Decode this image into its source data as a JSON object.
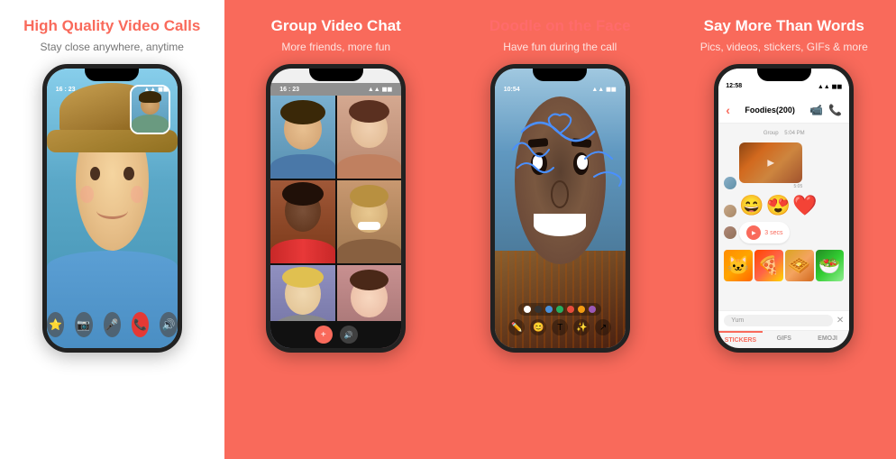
{
  "panels": [
    {
      "id": "panel-1",
      "background": "white",
      "title": "High Quality Video Calls",
      "subtitle": "Stay close anywhere, anytime",
      "titleColor": "pink",
      "subtitleColor": "gray",
      "phoneType": "video-call"
    },
    {
      "id": "panel-2",
      "background": "coral",
      "title": "Group Video Chat",
      "subtitle": "More friends, more fun",
      "titleColor": "white",
      "subtitleColor": "white",
      "phoneType": "group-video"
    },
    {
      "id": "panel-3",
      "background": "coral",
      "title": "Doodle on the Face",
      "subtitle": "Have fun during the call",
      "titleColor": "pink-on-coral",
      "subtitleColor": "white",
      "phoneType": "doodle"
    },
    {
      "id": "panel-4",
      "background": "coral",
      "title": "Say More Than Words",
      "subtitle": "Pics, videos, stickers, GIFs & more",
      "titleColor": "white",
      "subtitleColor": "white",
      "phoneType": "chat"
    }
  ],
  "phone1": {
    "statusTime": "16 : 23",
    "controls": [
      "star",
      "camera",
      "mic-off",
      "phone-end",
      "speaker"
    ]
  },
  "phone2": {
    "statusTime": "16 : 23",
    "gridPersons": [
      "👨",
      "👩",
      "👩🏾",
      "😂",
      "👨🏼",
      "👩🏻"
    ]
  },
  "phone3": {
    "statusTime": "10:54",
    "colors": [
      "white",
      "#333",
      "#4a90d9",
      "#27ae60",
      "#e74c3c",
      "#f39c12",
      "#9b59b6",
      "#e67e22"
    ]
  },
  "phone4": {
    "statusTime": "12:58",
    "groupName": "Foodies(200)",
    "messages": [
      {
        "type": "info",
        "text": "Group"
      },
      {
        "type": "received",
        "text": "food-image"
      },
      {
        "type": "received-emoji",
        "text": "😄😍"
      },
      {
        "type": "voice",
        "text": "3 secs"
      },
      {
        "type": "received",
        "text": "sticker-grid"
      }
    ],
    "inputPlaceholder": "Yum",
    "tabs": [
      "STICKERS",
      "GIFS",
      "EMOJI"
    ]
  }
}
